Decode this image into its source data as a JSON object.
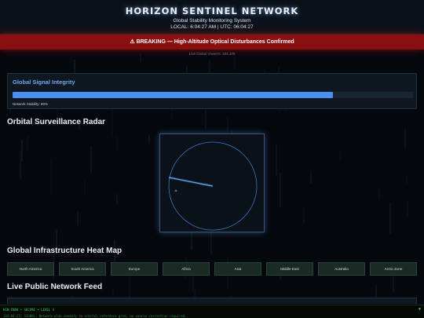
{
  "header": {
    "title": "HORIZON SENTINEL NETWORK",
    "subtitle": "Global Stability Monitoring System",
    "clock": "LOCAL: 6:04:27 AM | UTC: 06:04:27"
  },
  "breaking": {
    "icon": "warning-icon",
    "text": "⚠ BREAKING — High-Altitude Optical Disturbances Confirmed"
  },
  "viewers": "Live Global Viewers: 184,339",
  "signal": {
    "title": "Global Signal Integrity",
    "stability_label": "Network Stability: 80%",
    "stability_value": 0.8,
    "accent": "#4a8ff0"
  },
  "radar": {
    "title": "Orbital Surveillance Radar",
    "accent": "#3b84d6"
  },
  "heatmap": {
    "title": "Global Infrastructure Heat Map",
    "regions": [
      "North America",
      "South America",
      "Europe",
      "Africa",
      "Asia",
      "Middle East",
      "Australia",
      "Arctic Zone"
    ]
  },
  "feed": {
    "title": "Live Public Network Feed"
  },
  "ticker": {
    "status": "HSN-CNBA • SECURE • LEVEL 4",
    "message": "[03:04:21] SIGNAL: Network-wide anomaly in orbital reference grid, no course correction required.",
    "toggle": "▼"
  }
}
